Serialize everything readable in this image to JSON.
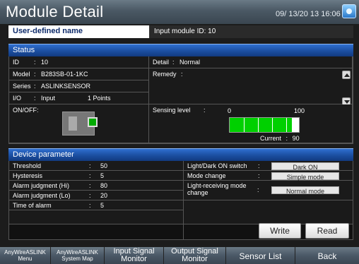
{
  "header": {
    "title": "Module Detail",
    "datetime": "09/ 13/20 13  16:06",
    "icon": "app-status-icon"
  },
  "user_defined": {
    "label": "User-defined name",
    "value": "Input module ID: 10"
  },
  "status": {
    "title": "Status",
    "rows": [
      {
        "key": "ID",
        "sep": ":",
        "value": "10"
      },
      {
        "key": "Model",
        "sep": ":",
        "value": "B283SB-01-1KC"
      },
      {
        "key": "Series",
        "sep": ":",
        "value": "ASLINKSENSOR"
      },
      {
        "key": "I/O",
        "sep": ":",
        "value": "Input",
        "extra": "1 Points"
      }
    ],
    "onoff_label": "ON/OFF:",
    "detail_label": "Detail",
    "detail_sep": ":",
    "detail_value": "Normal",
    "remedy_label": "Remedy",
    "remedy_sep": ":",
    "remedy_value": "",
    "sensing": {
      "label": "Sensing level",
      "sep": ":",
      "min": "0",
      "max": "100",
      "current_label": "Current",
      "current_sep": ":",
      "current_value": "90",
      "level_percent": 90,
      "color": "#00d000"
    }
  },
  "device": {
    "title": "Device parameter",
    "left": [
      {
        "key": "Threshold",
        "sep": ":",
        "value": "50"
      },
      {
        "key": "Hysteresis",
        "sep": ":",
        "value": "5"
      },
      {
        "key": "Alarm judgment (Hi)",
        "sep": ":",
        "value": "80"
      },
      {
        "key": "Alarm judgment (Lo)",
        "sep": ":",
        "value": "20"
      },
      {
        "key": "Time of alarm",
        "sep": ":",
        "value": "5"
      }
    ],
    "right": [
      {
        "key": "Light/Dark ON switch",
        "sep": ":",
        "value": "Dark ON"
      },
      {
        "key": "Mode change",
        "sep": ":",
        "value": "Simple mode"
      },
      {
        "key": "Light-receiving mode change",
        "sep": ":",
        "value": "Normal mode"
      }
    ],
    "write_label": "Write",
    "read_label": "Read"
  },
  "nav": {
    "items": [
      {
        "line1": "AnyWireASLINK",
        "line2": "Menu"
      },
      {
        "line1": "AnyWireASLINK",
        "line2": "System Map"
      },
      {
        "line1": "Input Signal",
        "line2": "Monitor"
      },
      {
        "line1": "Output Signal",
        "line2": "Monitor"
      },
      {
        "line1": "Sensor List",
        "line2": ""
      },
      {
        "line1": "Back",
        "line2": ""
      }
    ]
  },
  "colors": {
    "header": "#4a5864",
    "section_bar": "#1b4ea0",
    "level_fill": "#00d000"
  }
}
